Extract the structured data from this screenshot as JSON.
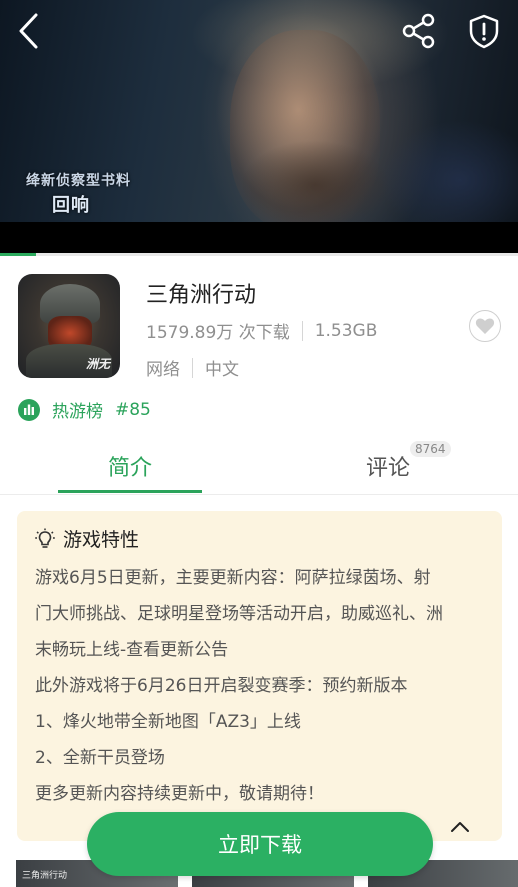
{
  "hero": {
    "caption_line1": "绛新侦察型书料",
    "caption_line2": "回响",
    "progress_fraction": 0.07
  },
  "app": {
    "name": "三角洲行动",
    "downloads": "1579.89万 次下载",
    "size": "1.53GB",
    "type": "网络",
    "language": "中文",
    "icon_tag": "洲无"
  },
  "rank": {
    "label": "热游榜",
    "number": "#85"
  },
  "tabs": {
    "intro": "简介",
    "reviews": "评论",
    "reviews_count": "8764"
  },
  "features": {
    "title": "游戏特性",
    "lines": [
      "游戏6月5日更新，主要更新内容：阿萨拉绿茵场、射",
      "门大师挑战、足球明星登场等活动开启，助威巡礼、洲",
      "末畅玩上线-查看更新公告",
      "此外游戏将于6月26日开启裂变赛季：预约新版本",
      "1、烽火地带全新地图「AZ3」上线",
      "2、全新干员登场",
      "更多更新内容持续更新中，敬请期待！"
    ]
  },
  "download_button": "立即下载",
  "thumb_logo": "三角洲行动",
  "colors": {
    "accent": "#2ba35b",
    "button": "#2bb063",
    "card_bg": "#fcf4e0"
  },
  "icons": [
    "back-icon",
    "share-icon",
    "shield-alert-icon",
    "heart-icon",
    "chart-icon",
    "lightbulb-icon",
    "chevron-up-icon"
  ]
}
